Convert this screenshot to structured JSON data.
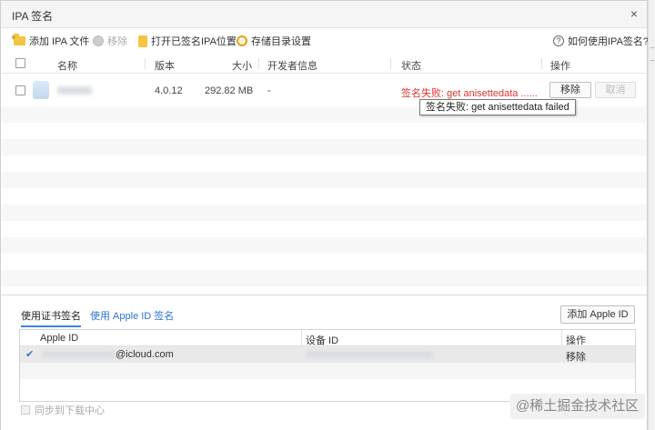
{
  "window": {
    "title": "IPA 签名",
    "close_glyph": "×"
  },
  "toolbar": {
    "add_ipa": "添加 IPA 文件",
    "remove": "移除",
    "open_signed": "打开已签名IPA位置",
    "storage_settings": "存储目录设置",
    "help": "如何使用IPA签名?"
  },
  "table": {
    "headers": {
      "name": "名称",
      "version": "版本",
      "size": "大小",
      "developer": "开发者信息",
      "status": "状态",
      "action": "操作"
    },
    "row": {
      "version": "4.0.12",
      "size": "292.82 MB",
      "developer": "-",
      "status": "签名失败: get anisettedata ......",
      "remove_label": "移除",
      "cancel_label": "取消"
    },
    "tooltip": "签名失败: get anisettedata failed"
  },
  "sign": {
    "tab_cert": "使用证书签名",
    "tab_appleid": "使用 Apple ID 签名",
    "add_apple_id": "添加 Apple ID",
    "id_headers": {
      "apple_id": "Apple ID",
      "device_id": "设备 ID",
      "action": "操作"
    },
    "id_row": {
      "email_suffix": "@icloud.com",
      "action": "移除"
    },
    "sync_label": "同步到下载中心"
  },
  "watermark": "@稀土掘金技术社区",
  "colors": {
    "error": "#e0322c",
    "link": "#2f73d6",
    "check": "#2f73d6"
  },
  "icons": [
    "folder-add-icon",
    "remove-circle-icon",
    "folder-open-icon",
    "gear-icon",
    "help-icon",
    "close-icon",
    "check-icon"
  ]
}
